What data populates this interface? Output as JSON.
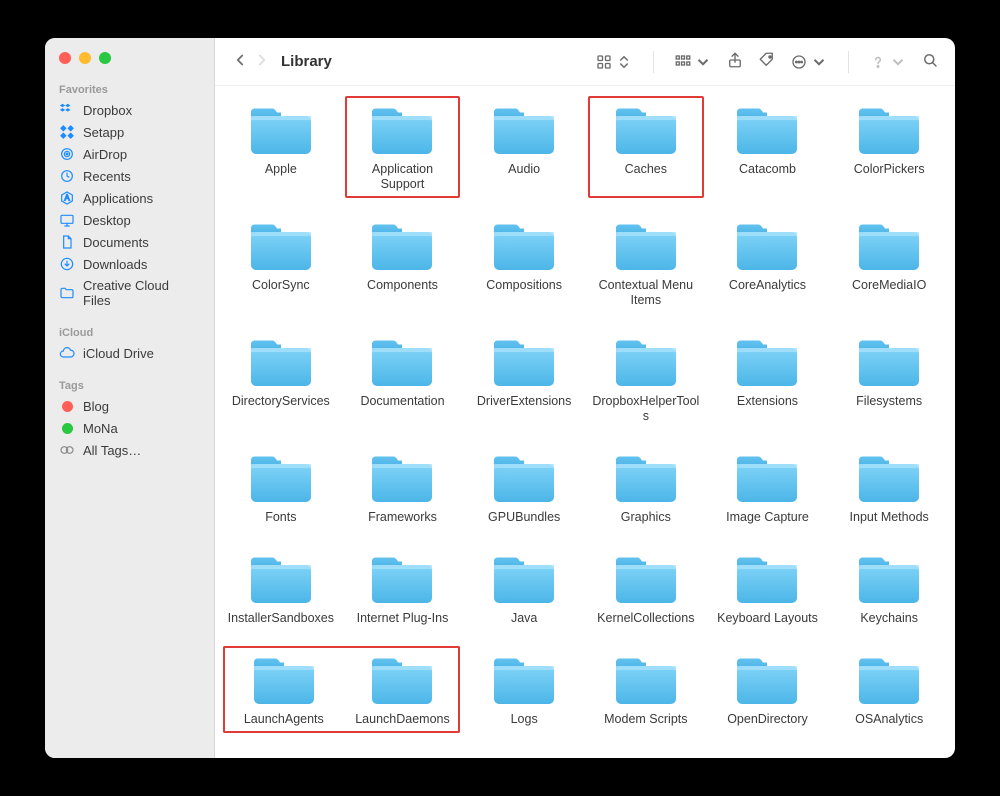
{
  "window_title": "Library",
  "sidebar": {
    "sections": [
      {
        "title": "Favorites",
        "items": [
          {
            "icon": "dropbox",
            "label": "Dropbox"
          },
          {
            "icon": "setapp",
            "label": "Setapp"
          },
          {
            "icon": "airdrop",
            "label": "AirDrop"
          },
          {
            "icon": "recents",
            "label": "Recents"
          },
          {
            "icon": "apps",
            "label": "Applications"
          },
          {
            "icon": "desktop",
            "label": "Desktop"
          },
          {
            "icon": "doc",
            "label": "Documents"
          },
          {
            "icon": "download",
            "label": "Downloads"
          },
          {
            "icon": "folder",
            "label": "Creative Cloud Files"
          }
        ]
      },
      {
        "title": "iCloud",
        "items": [
          {
            "icon": "icloud",
            "label": "iCloud Drive"
          }
        ]
      },
      {
        "title": "Tags",
        "items": [
          {
            "icon": "tag-dot",
            "color": "#ff5f57",
            "label": "Blog"
          },
          {
            "icon": "tag-dot",
            "color": "#28c840",
            "label": "MoNa"
          },
          {
            "icon": "tag-all",
            "label": "All Tags…"
          }
        ]
      }
    ]
  },
  "folders": [
    {
      "name": "Apple",
      "highlight": false
    },
    {
      "name": "Application Support",
      "highlight": true
    },
    {
      "name": "Audio",
      "highlight": false
    },
    {
      "name": "Caches",
      "highlight": true
    },
    {
      "name": "Catacomb",
      "highlight": false
    },
    {
      "name": "ColorPickers",
      "highlight": false
    },
    {
      "name": "ColorSync",
      "highlight": false
    },
    {
      "name": "Components",
      "highlight": false
    },
    {
      "name": "Compositions",
      "highlight": false
    },
    {
      "name": "Contextual Menu Items",
      "highlight": false
    },
    {
      "name": "CoreAnalytics",
      "highlight": false
    },
    {
      "name": "CoreMediaIO",
      "highlight": false
    },
    {
      "name": "DirectoryServices",
      "highlight": false
    },
    {
      "name": "Documentation",
      "highlight": false
    },
    {
      "name": "DriverExtensions",
      "highlight": false
    },
    {
      "name": "DropboxHelperTools",
      "highlight": false
    },
    {
      "name": "Extensions",
      "highlight": false
    },
    {
      "name": "Filesystems",
      "highlight": false
    },
    {
      "name": "Fonts",
      "highlight": false
    },
    {
      "name": "Frameworks",
      "highlight": false
    },
    {
      "name": "GPUBundles",
      "highlight": false
    },
    {
      "name": "Graphics",
      "highlight": false
    },
    {
      "name": "Image Capture",
      "highlight": false
    },
    {
      "name": "Input Methods",
      "highlight": false
    },
    {
      "name": "InstallerSandboxes",
      "highlight": false
    },
    {
      "name": "Internet Plug-Ins",
      "highlight": false
    },
    {
      "name": "Java",
      "highlight": false
    },
    {
      "name": "KernelCollections",
      "highlight": false
    },
    {
      "name": "Keyboard Layouts",
      "highlight": false
    },
    {
      "name": "Keychains",
      "highlight": false
    },
    {
      "name": "LaunchAgents",
      "highlight": true
    },
    {
      "name": "LaunchDaemons",
      "highlight": true
    },
    {
      "name": "Logs",
      "highlight": false
    },
    {
      "name": "Modem Scripts",
      "highlight": false
    },
    {
      "name": "OpenDirectory",
      "highlight": false
    },
    {
      "name": "OSAnalytics",
      "highlight": false
    }
  ],
  "highlight_pairs": [
    [
      30,
      31
    ]
  ]
}
